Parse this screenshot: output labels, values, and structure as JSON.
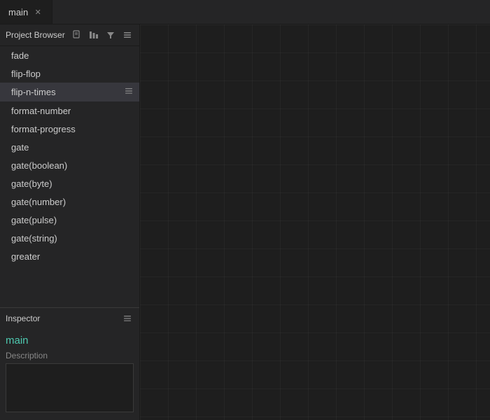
{
  "tabBar": {
    "tabs": [
      {
        "label": "main",
        "active": true,
        "closable": true
      }
    ]
  },
  "sidebar": {
    "projectBrowser": {
      "title": "Project Browser",
      "icons": [
        "new-file-icon",
        "sort-icon",
        "filter-icon",
        "menu-icon"
      ]
    },
    "items": [
      {
        "label": "fade",
        "active": false,
        "hasIcon": false
      },
      {
        "label": "flip-flop",
        "active": false,
        "hasIcon": false
      },
      {
        "label": "flip-n-times",
        "active": true,
        "hasIcon": true
      },
      {
        "label": "format-number",
        "active": false,
        "hasIcon": false
      },
      {
        "label": "format-progress",
        "active": false,
        "hasIcon": false
      },
      {
        "label": "gate",
        "active": false,
        "hasIcon": false
      },
      {
        "label": "gate(boolean)",
        "active": false,
        "hasIcon": false
      },
      {
        "label": "gate(byte)",
        "active": false,
        "hasIcon": false
      },
      {
        "label": "gate(number)",
        "active": false,
        "hasIcon": false
      },
      {
        "label": "gate(pulse)",
        "active": false,
        "hasIcon": false
      },
      {
        "label": "gate(string)",
        "active": false,
        "hasIcon": false
      },
      {
        "label": "greater",
        "active": false,
        "hasIcon": false
      }
    ]
  },
  "inspector": {
    "title": "Inspector",
    "componentName": "main",
    "descriptionLabel": "Description",
    "descriptionPlaceholder": "",
    "descriptionValue": ""
  }
}
